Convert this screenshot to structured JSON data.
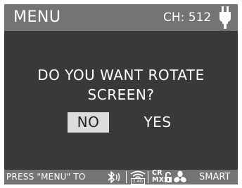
{
  "header": {
    "title": "MENU",
    "channel_label": "CH: 512",
    "power_icon": "plug-icon"
  },
  "dialog": {
    "question_line1": "DO YOU WANT ROTATE",
    "question_line2": "SCREEN?",
    "options": [
      {
        "label": "NO",
        "selected": true
      },
      {
        "label": "YES",
        "selected": false
      }
    ]
  },
  "footer": {
    "hint_text": "PRESS \"MENU\" TO",
    "icons": [
      "bluetooth-icon",
      "wifi-icon",
      "crmx-lock-icon",
      "fan-icon"
    ],
    "wifi_band": "2.4G",
    "crmx_line1": "CR",
    "crmx_line2": "MX",
    "fan_mode": "SMART"
  },
  "colors": {
    "background": "#393939",
    "bars": "#747474",
    "text": "#ffffff",
    "selection": "#dcdcdc"
  }
}
